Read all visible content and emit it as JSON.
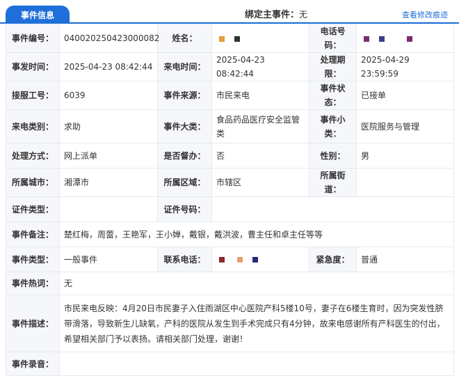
{
  "header": {
    "tab_label": "事件信息",
    "bind_label": "绑定主事件：",
    "bind_value": "无",
    "history_link": "查看修改痕迹"
  },
  "fields": {
    "event_no": {
      "label": "事件编号：",
      "value": "040020250423000082"
    },
    "name": {
      "label": "姓名："
    },
    "phone": {
      "label": "电话号码："
    },
    "occur_time": {
      "label": "事发时间：",
      "value": "2025-04-23 08:42:44"
    },
    "call_time": {
      "label": "来电时间：",
      "value": "2025-04-23 08:42:44"
    },
    "deadline": {
      "label": "处理期限：",
      "value": "2025-04-29 23:59:59"
    },
    "operator_id": {
      "label": "接服工号：",
      "value": "6039"
    },
    "source": {
      "label": "事件来源：",
      "value": "市民来电"
    },
    "status": {
      "label": "事件状态：",
      "value": "已接单"
    },
    "call_category": {
      "label": "来电类别：",
      "value": "求助"
    },
    "major_category": {
      "label": "事件大类：",
      "value": "食品药品医疗安全监管类"
    },
    "minor_category": {
      "label": "事件小类：",
      "value": "医院服务与管理"
    },
    "handling": {
      "label": "处理方式：",
      "value": "网上派单"
    },
    "supervise": {
      "label": "是否督办：",
      "value": "否"
    },
    "gender": {
      "label": "性别：",
      "value": "男"
    },
    "city": {
      "label": "所属城市：",
      "value": "湘潭市"
    },
    "district": {
      "label": "所属区域：",
      "value": "市辖区"
    },
    "street": {
      "label": "所属街道：",
      "value": ""
    },
    "id_type": {
      "label": "证件类型：",
      "value": ""
    },
    "id_no": {
      "label": "证件号码：",
      "value": ""
    },
    "remark": {
      "label": "事件备注：",
      "value": "楚红梅，周蕾，王艳军，王小婵，戴银，戴洪波，曹主任和卓主任等等"
    },
    "event_type": {
      "label": "事件类型：",
      "value": "一般事件"
    },
    "contact_phone": {
      "label": "联系电话："
    },
    "urgency": {
      "label": "紧急度：",
      "value": "普通"
    },
    "hotword": {
      "label": "事件热词：",
      "value": "无"
    },
    "description": {
      "label": "事件描述：",
      "value": "市民来电反映：4月20日市民妻子入住雨湖区中心医院产科5楼10号，妻子在6楼生育时，因为突发性脐带滑落，导致新生儿缺氧，产科的医院从发生到手术完成只有4分钟，故来电感谢所有产科医生的付出，希望相关部门予以表扬。请相关部门处理，谢谢！"
    },
    "recording": {
      "label": "事件录音：",
      "value": ""
    }
  },
  "mask_colors": {
    "name": [
      "#e89b3c",
      "#333333"
    ],
    "phone": [
      "#7b2d6e",
      "#3b3b8c",
      "#7b2d6e"
    ],
    "contact_phone": [
      "#8b2a2a",
      "#e6a070",
      "#2a2a7a"
    ]
  }
}
